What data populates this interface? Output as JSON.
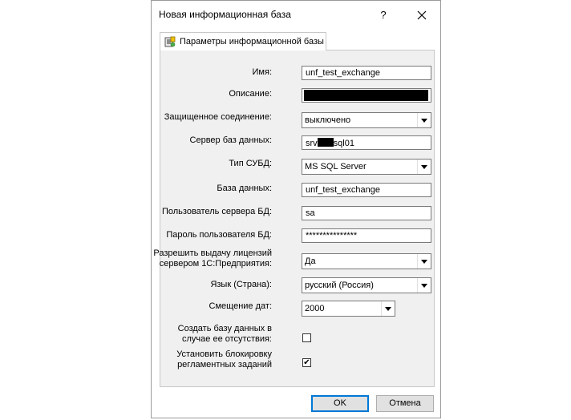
{
  "window": {
    "title": "Новая информационная база",
    "help_glyph": "?",
    "close_glyph": "✕"
  },
  "tab": {
    "label": "Параметры информационной базы",
    "icon": "infobase-params-icon"
  },
  "form": {
    "name": {
      "label": "Имя:",
      "value": "unf_test_exchange"
    },
    "description": {
      "label": "Описание:",
      "value": ""
    },
    "secure": {
      "label": "Защищенное соединение:",
      "value": "выключено"
    },
    "db_server": {
      "label": "Сервер баз данных:",
      "value_prefix": "srv",
      "value_suffix": "sql01"
    },
    "dbms_type": {
      "label": "Тип СУБД:",
      "value": "MS SQL Server"
    },
    "database": {
      "label": "База данных:",
      "value": "unf_test_exchange"
    },
    "db_user": {
      "label": "Пользователь сервера БД:",
      "value": "sa"
    },
    "db_password": {
      "label": "Пароль пользователя БД:",
      "value": "***************"
    },
    "licenses": {
      "label_line1": "Разрешить выдачу лицензий",
      "label_line2": "сервером 1С:Предприятия:",
      "value": "Да"
    },
    "language": {
      "label": "Язык (Страна):",
      "value": "русский (Россия)"
    },
    "date_offset": {
      "label": "Смещение дат:",
      "value": "2000"
    },
    "create_db": {
      "label_line1": "Создать базу данных в",
      "label_line2": "случае ее отсутствия:",
      "checked": false
    },
    "block_jobs": {
      "label_line1": "Установить блокировку",
      "label_line2": "регламентных заданий",
      "checked": true,
      "check_glyph": "✔"
    }
  },
  "buttons": {
    "ok": "OK",
    "cancel": "Отмена"
  }
}
